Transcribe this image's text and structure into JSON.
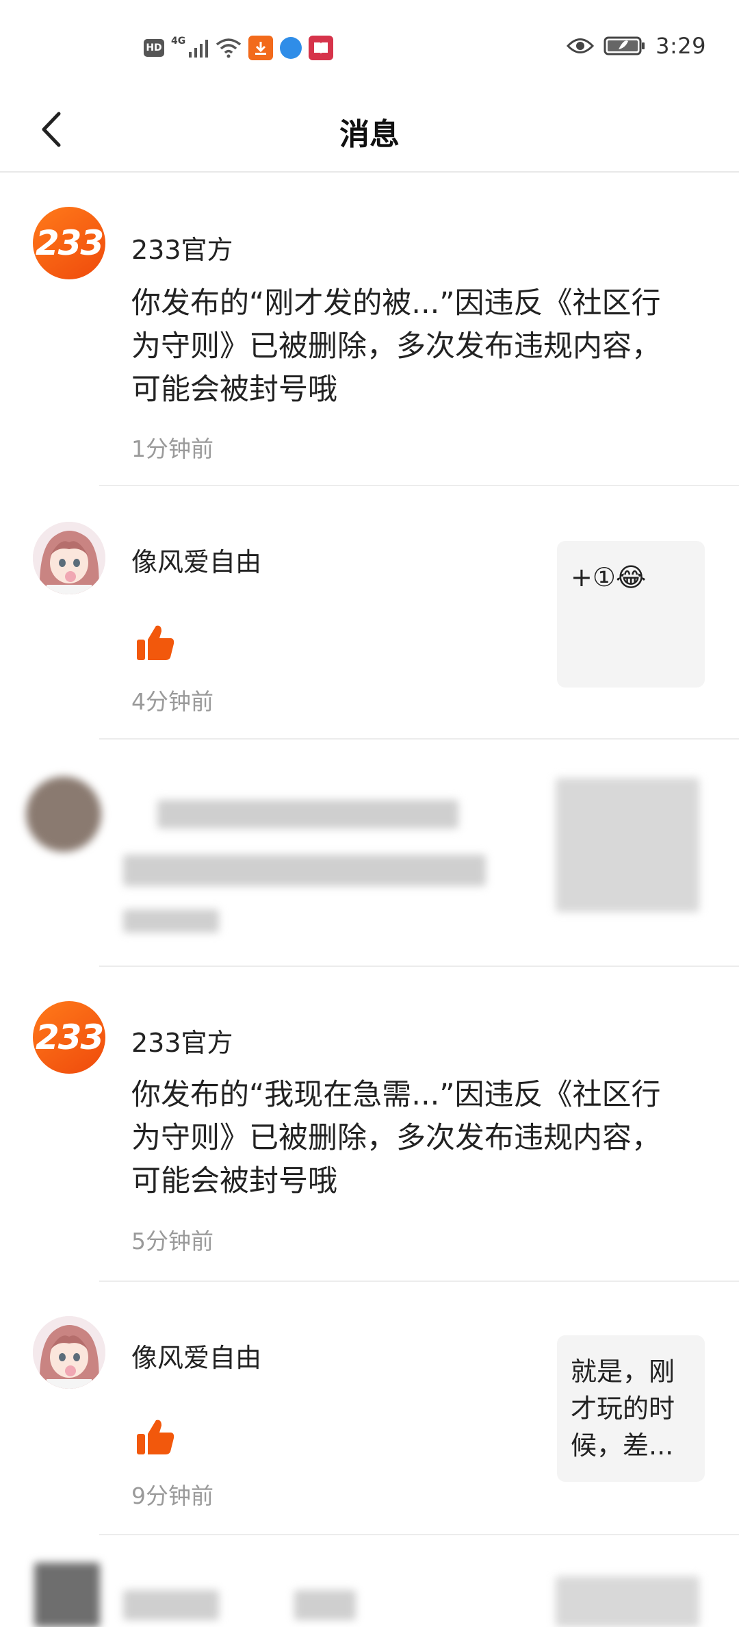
{
  "status_bar": {
    "hd": "HD",
    "network": "4G",
    "time": "3:29"
  },
  "nav": {
    "title": "消息",
    "back_icon": "chevron-left-icon"
  },
  "messages": [
    {
      "avatar_text": "233",
      "name": "233官方",
      "text": "你发布的“刚才发的被...”因违反《社区行为守则》已被删除，多次发布违规内容，可能会被封号哦",
      "time": "1分钟前"
    },
    {
      "name": "像风爱自由",
      "reaction": "thumbs-up-icon",
      "thumb_text": "+①😂",
      "time": "4分钟前"
    },
    {
      "blurred": true
    },
    {
      "avatar_text": "233",
      "name": "233官方",
      "text": "你发布的“我现在急需...”因违反《社区行为守则》已被删除，多次发布违规内容，可能会被封号哦",
      "time": "5分钟前"
    },
    {
      "name": "像风爱自由",
      "reaction": "thumbs-up-icon",
      "thumb_text": "就是，刚才玩的时候，差...",
      "time": "9分钟前"
    }
  ],
  "colors": {
    "brand_orange": "#f2580c",
    "divider": "#ececec",
    "muted_text": "#9a9a9a"
  }
}
